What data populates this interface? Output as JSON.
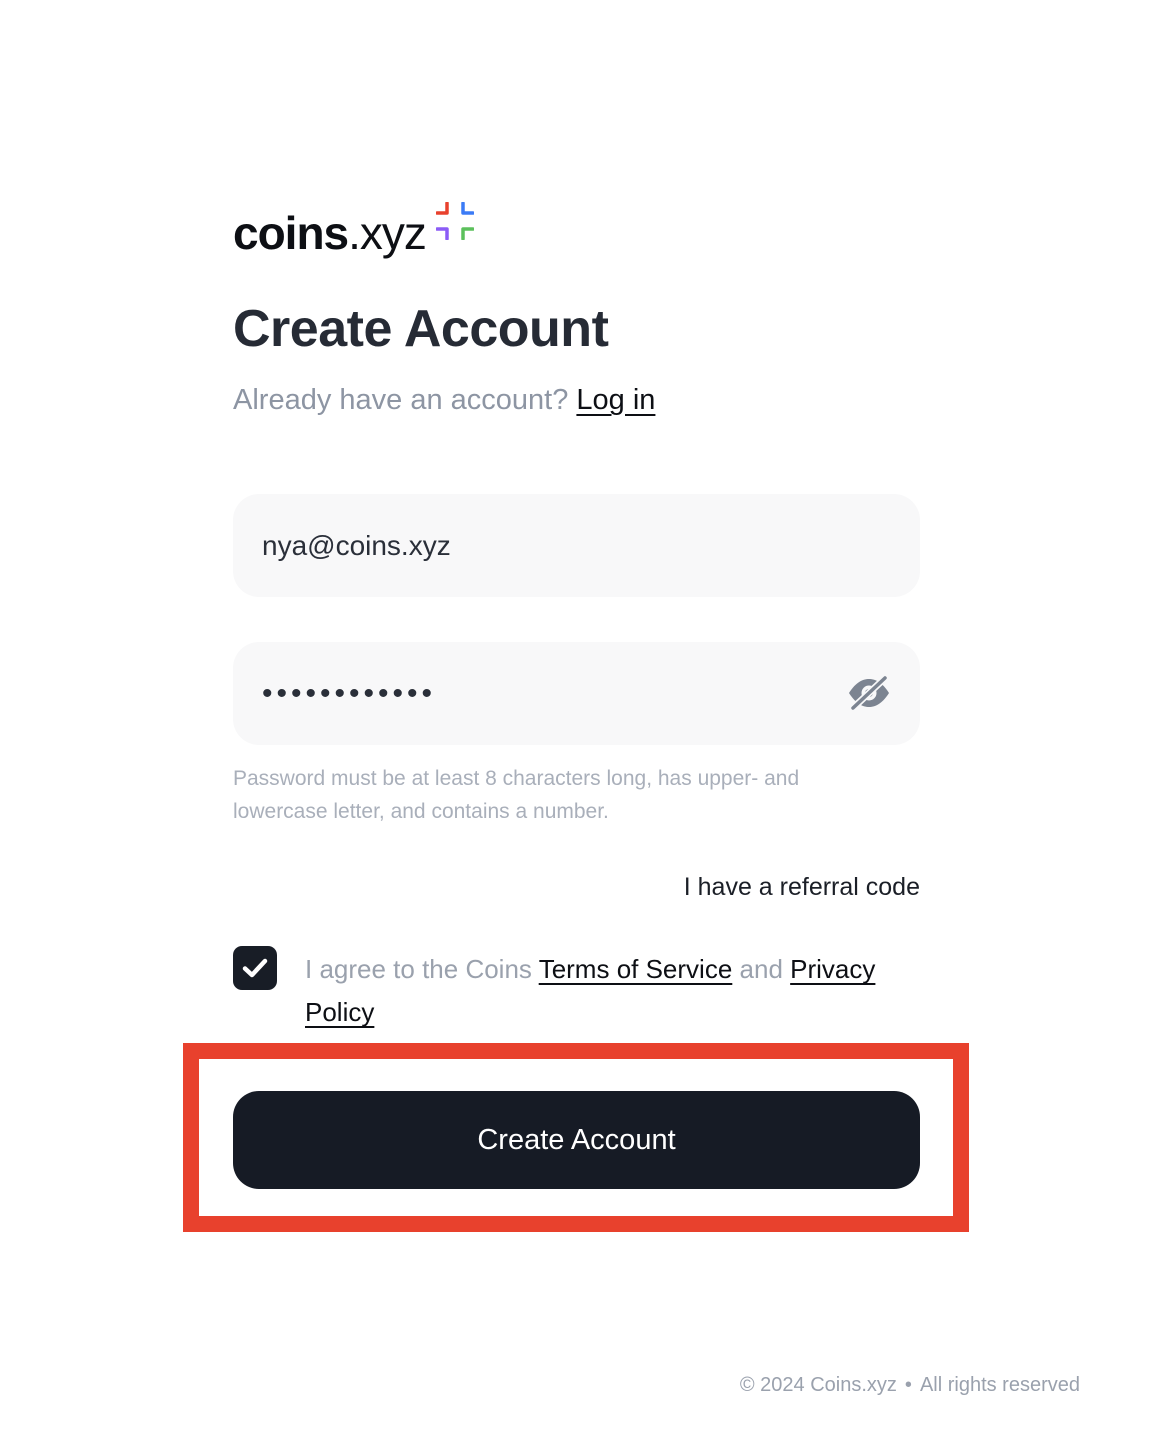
{
  "brand": {
    "logo_bold": "coins",
    "logo_light": ".xyz",
    "logo_colors": [
      "#e8412d",
      "#3b7bf6",
      "#8b5cf6",
      "#5cc05c"
    ]
  },
  "page": {
    "title": "Create Account",
    "login_prompt": "Already have an account?",
    "login_link": "Log in"
  },
  "form": {
    "email_value": "nya@coins.xyz",
    "password_value": "••••••••••••",
    "password_toggle_icon": "eye-slash-icon",
    "password_hint": "Password must be at least 8 characters long, has upper- and lowercase letter, and contains a number.",
    "referral_link": "I have a referral code",
    "agree": {
      "checked": true,
      "prefix": "I agree to the Coins",
      "terms_link": "Terms of Service",
      "and": "and",
      "privacy_link": "Privacy Policy"
    },
    "submit_label": "Create Account"
  },
  "footer": {
    "copyright": "© 2024 Coins.xyz",
    "separator": "•",
    "rights": "All rights reserved"
  },
  "colors": {
    "highlight": "#e8412d",
    "button_bg": "#161b25",
    "field_bg": "#f8f8f9"
  }
}
